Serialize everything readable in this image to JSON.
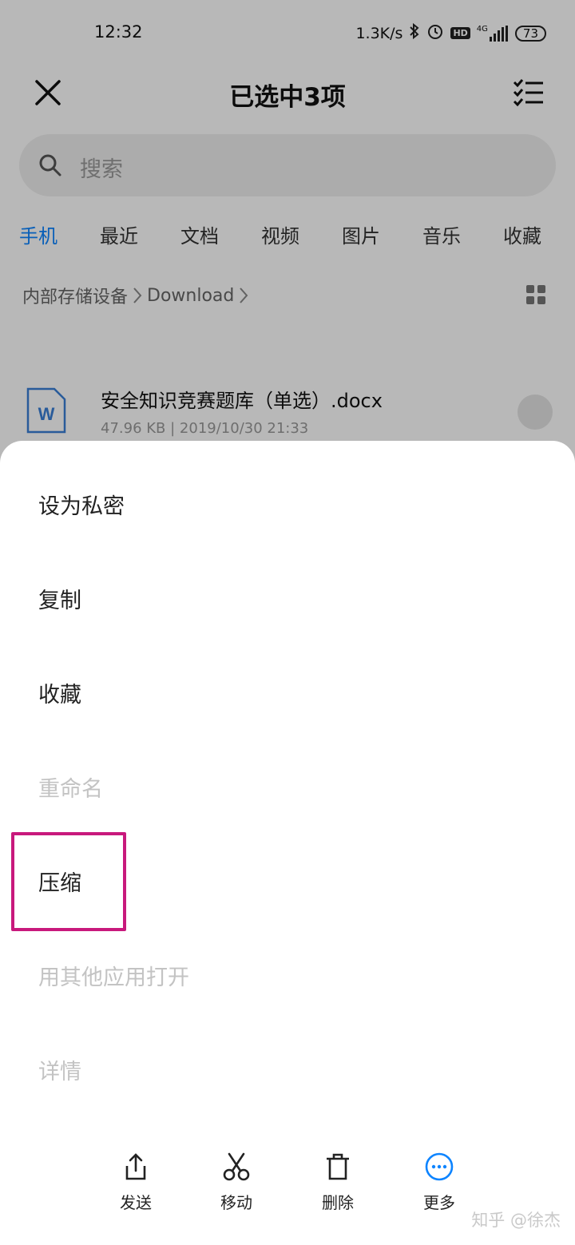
{
  "status_bar": {
    "time": "12:32",
    "net_speed": "1.3K/s",
    "hd_badge": "HD",
    "network": "4G",
    "battery": "73"
  },
  "header": {
    "title": "已选中3项"
  },
  "search": {
    "placeholder": "搜索"
  },
  "tabs": [
    {
      "label": "手机",
      "active": true
    },
    {
      "label": "最近",
      "active": false
    },
    {
      "label": "文档",
      "active": false
    },
    {
      "label": "视频",
      "active": false
    },
    {
      "label": "图片",
      "active": false
    },
    {
      "label": "音乐",
      "active": false
    },
    {
      "label": "收藏",
      "active": false
    }
  ],
  "breadcrumb": {
    "root": "内部存储设备",
    "folder": "Download"
  },
  "file": {
    "name": "安全知识竞赛题库（单选）.docx",
    "size": "47.96 KB",
    "date": "2019/10/30 21:33",
    "icon_letter": "W"
  },
  "menu": {
    "items": [
      {
        "label": "设为私密",
        "enabled": true
      },
      {
        "label": "复制",
        "enabled": true
      },
      {
        "label": "收藏",
        "enabled": true
      },
      {
        "label": "重命名",
        "enabled": false
      },
      {
        "label": "压缩",
        "enabled": true,
        "highlighted": true
      },
      {
        "label": "用其他应用打开",
        "enabled": false
      },
      {
        "label": "详情",
        "enabled": false
      }
    ]
  },
  "bottom_bar": {
    "send": "发送",
    "move": "移动",
    "delete": "删除",
    "more": "更多"
  },
  "watermark": "知乎 @徐杰",
  "colors": {
    "accent": "#0d84ff",
    "highlight_box": "#c8197c",
    "disabled_text": "#c3c3c3"
  }
}
